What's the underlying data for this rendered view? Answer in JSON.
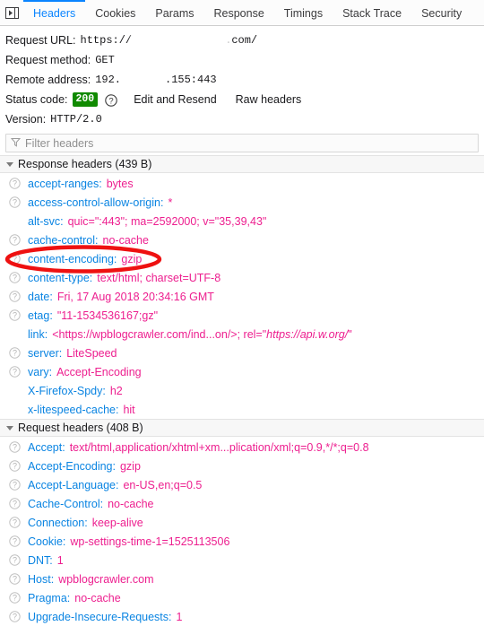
{
  "tabbar": {
    "panel_icon": "toggle-panel-icon",
    "tabs": [
      {
        "label": "Headers",
        "active": true
      },
      {
        "label": "Cookies",
        "active": false
      },
      {
        "label": "Params",
        "active": false
      },
      {
        "label": "Response",
        "active": false
      },
      {
        "label": "Timings",
        "active": false
      },
      {
        "label": "Stack Trace",
        "active": false
      },
      {
        "label": "Security",
        "active": false
      }
    ]
  },
  "summary": {
    "request_url_label": "Request URL:",
    "request_url_prefix": "https://",
    "request_url_suffix": ".com/",
    "request_method_label": "Request method:",
    "request_method_value": "GET",
    "remote_address_label": "Remote address:",
    "remote_address_prefix": "192.",
    "remote_address_suffix": ".155:443",
    "status_code_label": "Status code:",
    "status_code_value": "200",
    "status_help_icon": "help-icon",
    "edit_resend_label": "Edit and Resend",
    "raw_headers_label": "Raw headers",
    "version_label": "Version:",
    "version_value": "HTTP/2.0"
  },
  "filter": {
    "placeholder": "Filter headers",
    "value": "",
    "icon": "funnel-icon"
  },
  "response_section": {
    "title": "Response headers (439 B)",
    "headers": [
      {
        "name": "accept-ranges:",
        "value": "bytes",
        "help": true
      },
      {
        "name": "access-control-allow-origin:",
        "value": "*",
        "help": true
      },
      {
        "name": "alt-svc:",
        "value": "quic=\":443\"; ma=2592000; v=\"35,39,43\"",
        "help": false
      },
      {
        "name": "cache-control:",
        "value": "no-cache",
        "help": true
      },
      {
        "name": "content-encoding:",
        "value": "gzip",
        "help": true,
        "annotated": true
      },
      {
        "name": "content-type:",
        "value": "text/html; charset=UTF-8",
        "help": true
      },
      {
        "name": "date:",
        "value": "Fri, 17 Aug 2018 20:34:16 GMT",
        "help": true
      },
      {
        "name": "etag:",
        "value": "\"11-1534536167;gz\"",
        "help": true
      },
      {
        "name": "link:",
        "value": "<https://wpblogcrawler.com/ind...on/>; rel=\"",
        "value_italic": "https://api.w.org/",
        "value_tail": "\"",
        "help": false
      },
      {
        "name": "server:",
        "value": "LiteSpeed",
        "help": true
      },
      {
        "name": "vary:",
        "value": "Accept-Encoding",
        "help": true
      },
      {
        "name": "X-Firefox-Spdy:",
        "value": "h2",
        "help": false
      },
      {
        "name": "x-litespeed-cache:",
        "value": "hit",
        "help": false
      }
    ]
  },
  "request_section": {
    "title": "Request headers (408 B)",
    "headers": [
      {
        "name": "Accept:",
        "value": "text/html,application/xhtml+xm...plication/xml;q=0.9,*/*;q=0.8",
        "help": true
      },
      {
        "name": "Accept-Encoding:",
        "value": "gzip",
        "help": true
      },
      {
        "name": "Accept-Language:",
        "value": "en-US,en;q=0.5",
        "help": true
      },
      {
        "name": "Cache-Control:",
        "value": "no-cache",
        "help": true
      },
      {
        "name": "Connection:",
        "value": "keep-alive",
        "help": true
      },
      {
        "name": "Cookie:",
        "value": "wp-settings-time-1=1525113506",
        "help": true
      },
      {
        "name": "DNT:",
        "value": "1",
        "help": true
      },
      {
        "name": "Host:",
        "value": "wpblogcrawler.com",
        "help": true
      },
      {
        "name": "Pragma:",
        "value": "no-cache",
        "help": true
      },
      {
        "name": "Upgrade-Insecure-Requests:",
        "value": "1",
        "help": true
      }
    ]
  },
  "annotation": {
    "shape": "red-ellipse",
    "color": "#ee1111",
    "target": "content-encoding: gzip"
  },
  "colors": {
    "accent_tab": "#0a84ff",
    "header_name": "#0a84e2",
    "header_value": "#ed1f8f",
    "status_badge_bg": "#108a00",
    "annotation": "#ee1111"
  }
}
